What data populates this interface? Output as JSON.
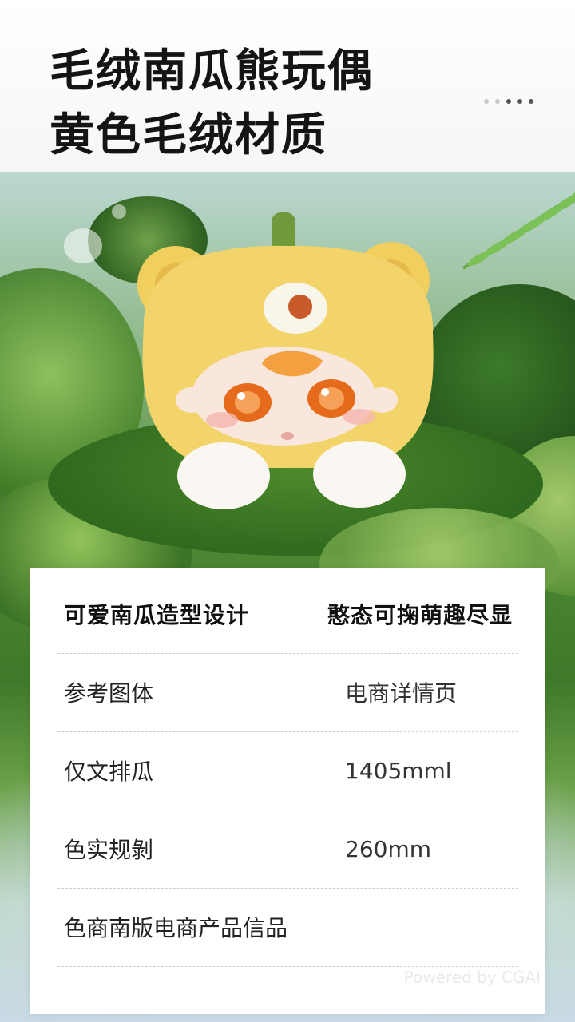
{
  "header": {
    "title_line1": "毛绒南瓜熊玩偶",
    "title_line2": "黄色毛绒材质"
  },
  "spec_table": {
    "highlights": {
      "left": "可爱南瓜造型设计",
      "right": "憨态可掬萌趣尽显"
    },
    "rows": [
      {
        "label": "参考图体",
        "value": "电商详情页"
      },
      {
        "label": "仅文排瓜",
        "value": "1405mml"
      },
      {
        "label": "色实规剝",
        "value": "260mm"
      },
      {
        "label": "色商南版电商产品信品",
        "value": ""
      }
    ]
  },
  "watermark": "Powered by CGAI",
  "colors": {
    "title": "#141414",
    "plush": "#f2d46a",
    "moss": "#4f8a35",
    "card": "#ffffff",
    "divider": "#cfcfcf"
  }
}
